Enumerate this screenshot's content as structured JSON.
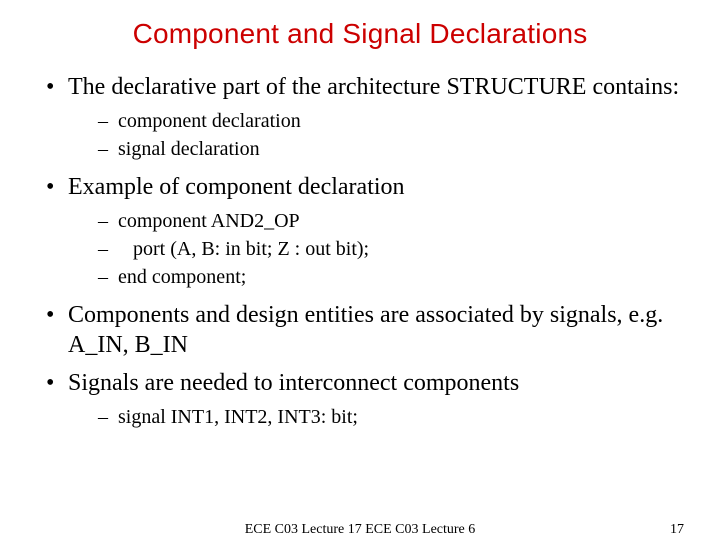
{
  "title": "Component and Signal Declarations",
  "bullets": {
    "b1": "The declarative part of the architecture STRUCTURE contains:",
    "b1s1": "component declaration",
    "b1s2": "signal declaration",
    "b2": "Example of component declaration",
    "b2s1": "component AND2_OP",
    "b2s2": "   port (A, B: in bit; Z : out bit);",
    "b2s3": "end component;",
    "b3": "Components and design entities are associated by signals, e.g. A_IN, B_IN",
    "b4": "Signals are needed to interconnect components",
    "b4s1": "signal INT1, INT2, INT3: bit;"
  },
  "footer": {
    "center": "ECE C03 Lecture 17 ECE C03 Lecture 6",
    "page": "17"
  }
}
